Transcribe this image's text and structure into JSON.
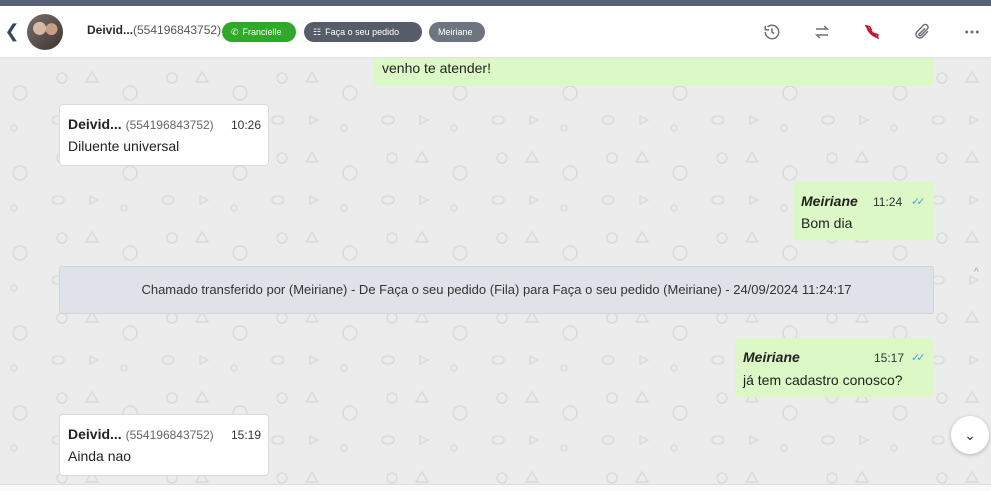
{
  "header": {
    "contact_name": "Deivid...",
    "contact_phone": "(554196843752)",
    "badges": {
      "agent": "Francielle",
      "queue": "Faça o seu pedido",
      "attendant": "Meiriane"
    },
    "icons": [
      "back-icon",
      "history-icon",
      "transfer-icon",
      "hangup-icon",
      "attach-icon",
      "more-icon"
    ]
  },
  "messages": {
    "m0": {
      "text": "venho te atender!"
    },
    "m1": {
      "name": "Deivid...",
      "phone": "(554196843752)",
      "time": "10:26",
      "text": "Diluente universal"
    },
    "m2": {
      "name": "Meiriane",
      "time": "11:24",
      "text": "Bom dia"
    },
    "system": {
      "text": "Chamado transferido por (Meiriane) - De Faça o seu pedido (Fila) para Faça o seu pedido (Meiriane) - 24/09/2024 11:24:17"
    },
    "m3": {
      "name": "Meiriane",
      "time": "15:17",
      "text": "já tem cadastro conosco?"
    },
    "m4": {
      "name": "Deivid...",
      "phone": "(554196843752)",
      "time": "15:19",
      "text": "Ainda nao"
    }
  },
  "colors": {
    "accent_green": "#30a829",
    "outgoing_bubble": "#dcf8c6",
    "hangup_red": "#c8102e",
    "read_ticks": "#4fa3e0"
  }
}
